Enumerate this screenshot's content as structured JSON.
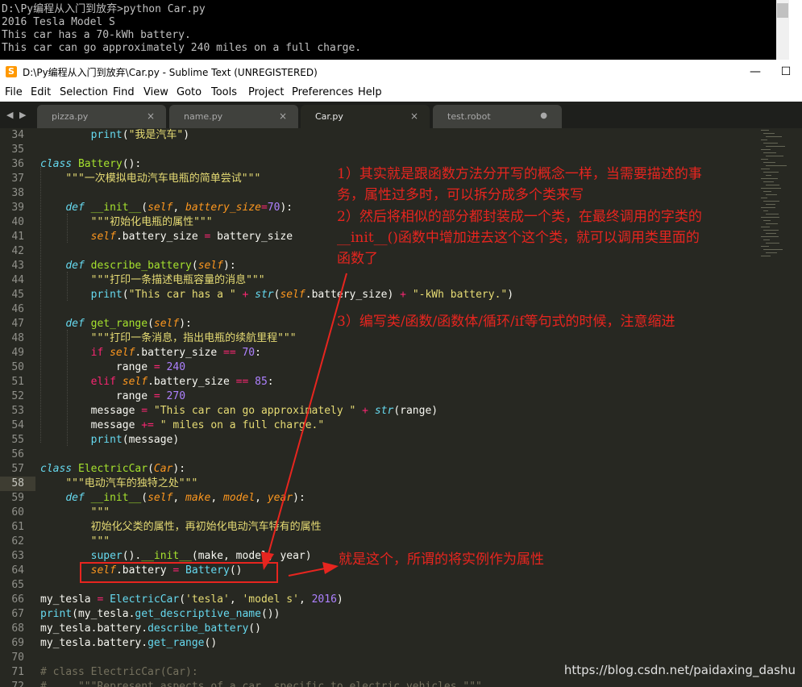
{
  "console": {
    "lines": [
      "D:\\Py编程从入门到放弃>python Car.py",
      "2016 Tesla Model S",
      "This car has a 70-kWh battery.",
      "This car can go approximately 240 miles on a full charge."
    ]
  },
  "window": {
    "title": "D:\\Py编程从入门到放弃\\Car.py - Sublime Text (UNREGISTERED)",
    "app_icon_letter": "S",
    "minimize": "—",
    "maximize": "☐"
  },
  "menu": [
    "File",
    "Edit",
    "Selection",
    "Find",
    "View",
    "Goto",
    "Tools",
    "Project",
    "Preferences",
    "Help"
  ],
  "tabs": [
    {
      "label": "pizza.py",
      "state": "close"
    },
    {
      "label": "name.py",
      "state": "close"
    },
    {
      "label": "Car.py",
      "state": "active"
    },
    {
      "label": "test.robot",
      "state": "dirty"
    }
  ],
  "tab_glyphs": {
    "close": "×",
    "dirty": "●",
    "left": "◀",
    "right": "▶"
  },
  "code": {
    "current_line": 58,
    "line_numbers": [
      "34",
      "35",
      "36",
      "37",
      "38",
      "39",
      "40",
      "41",
      "42",
      "43",
      "44",
      "45",
      "46",
      "47",
      "48",
      "49",
      "50",
      "51",
      "52",
      "53",
      "54",
      "55",
      "56",
      "57",
      "58",
      "59",
      "60",
      "61",
      "62",
      "63",
      "64",
      "65",
      "66",
      "67",
      "68",
      "69",
      "70",
      "71",
      "72"
    ]
  },
  "annotations": {
    "note1_line1": "1）其实就是跟函数方法分开写的概念一样，当需要描述的事",
    "note1_line2": "务，属性过多时，可以拆分成多个类来写",
    "note2_line1": "2）然后将相似的部分都封装成一个类，在最终调用的字类的",
    "note2_line2": "__init__()函数中增加进去这个这个类，就可以调用类里面的",
    "note2_line3": "函数了",
    "note3": "3）编写类/函数/函数体/循环/if等句式的时候，注意缩进",
    "note4": "就是这个，所谓的将实例作为属性",
    "color": "#e7251f"
  },
  "watermark": "https://blog.csdn.net/paidaxing_dashu"
}
